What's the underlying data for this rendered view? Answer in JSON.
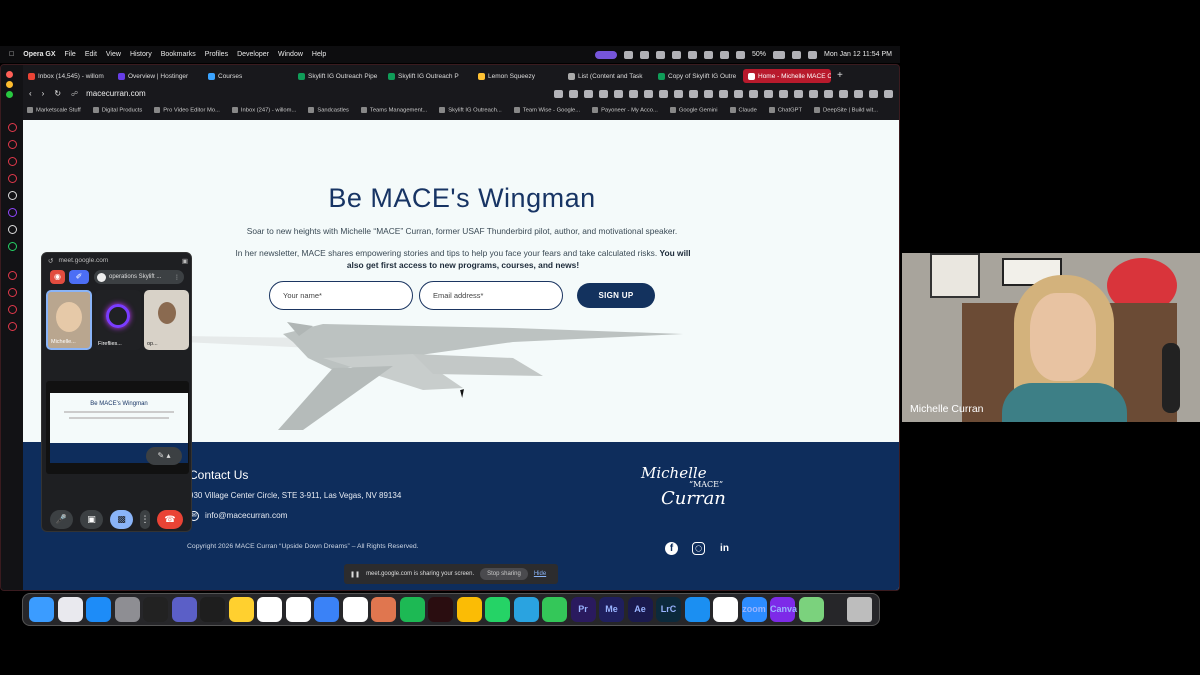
{
  "menubar": {
    "app": "Opera GX",
    "menus": [
      "File",
      "Edit",
      "View",
      "History",
      "Bookmarks",
      "Profiles",
      "Developer",
      "Window",
      "Help"
    ],
    "battery": "50%",
    "datetime": "Mon Jan 12  11:54 PM"
  },
  "browser": {
    "tabs": [
      {
        "label": "Inbox (14,545) - willom",
        "color": "#ea4335"
      },
      {
        "label": "Overview | Hostinger",
        "color": "#673de6"
      },
      {
        "label": "Courses",
        "color": "#3aa3ff"
      },
      {
        "label": "Skylift IG Outreach Pipe",
        "color": "#0f9d58"
      },
      {
        "label": "Skylift IG Outreach P",
        "color": "#0f9d58"
      },
      {
        "label": "Lemon Squeezy",
        "color": "#ffc233"
      },
      {
        "label": "List (Content and Task",
        "color": "#aaaaaa"
      },
      {
        "label": "Copy of Skylift IG Outre",
        "color": "#0f9d58"
      },
      {
        "label": "Home - Michelle MACE C",
        "color": "#ffffff"
      }
    ],
    "url": "macecurran.com",
    "bookmarks": [
      "Marketscale Stuff",
      "Digital Products",
      "Pro Video Editor Mo...",
      "Inbox (247) - willom...",
      "Sandcastles",
      "Teams Management...",
      "Skylift IG Outreach...",
      "Team Wise - Google...",
      "Payoneer - My Acco...",
      "Google Gemini",
      "Claude",
      "ChatGPT",
      "DeepSite | Build wit..."
    ]
  },
  "page": {
    "title": "Be MACE's Wingman",
    "subtitle": "Soar to new heights with Michelle “MACE” Curran, former USAF Thunderbird pilot, author, and motivational speaker.",
    "para_normal": "In her newsletter, MACE shares empowering stories and tips to help you face your fears and take calculated risks.",
    "para_bold": "You will also get first access to new programs, courses, and news!",
    "name_placeholder": "Your name*",
    "email_placeholder": "Email address*",
    "signup_label": "SIGN UP"
  },
  "footer": {
    "contact_heading": "Contact Us",
    "address": "930 Village Center Circle, STE 3-911, Las Vegas, NV 89134",
    "email": "info@macecurran.com",
    "copyright": "Copyright 2026 MACE Curran “Upside Down Dreams” – All Rights Reserved.",
    "logo_line1": "Michelle",
    "logo_line2": "“MACE”",
    "logo_line3": "Curran"
  },
  "share": {
    "message": "meet.google.com is sharing your screen.",
    "stop_label": "Stop sharing",
    "hide_label": "Hide"
  },
  "meet": {
    "url": "meet.google.com",
    "call_name": "operations Skylift ...",
    "tiles": [
      "Michelle...",
      "Fireflies...",
      "op..."
    ],
    "preview_title": "Be MACE's Wingman"
  },
  "webcam": {
    "name": "Michelle Curran"
  },
  "dock": {
    "apps": [
      {
        "name": "finder-icon",
        "color": "#3b9cff"
      },
      {
        "name": "launchpad-icon",
        "color": "#e9e9ee"
      },
      {
        "name": "app-store-icon",
        "color": "#1d8cf8"
      },
      {
        "name": "settings-icon",
        "color": "#8e8e93"
      },
      {
        "name": "screen-recorder-icon",
        "color": "#222222"
      },
      {
        "name": "teams-icon",
        "color": "#5b5fc7"
      },
      {
        "name": "figma-icon",
        "color": "#1e1e1e"
      },
      {
        "name": "miro-icon",
        "color": "#ffd02f"
      },
      {
        "name": "notion-icon",
        "color": "#ffffff"
      },
      {
        "name": "slack-icon",
        "color": "#ffffff"
      },
      {
        "name": "tasks-icon",
        "color": "#3a82f7"
      },
      {
        "name": "chatgpt-icon",
        "color": "#ffffff"
      },
      {
        "name": "claude-icon",
        "color": "#e0764f"
      },
      {
        "name": "spotify-icon",
        "color": "#1db954"
      },
      {
        "name": "opera-icon",
        "color": "#2a0d10"
      },
      {
        "name": "chrome-icon",
        "color": "#fbbc05"
      },
      {
        "name": "whatsapp-icon",
        "color": "#25d366"
      },
      {
        "name": "telegram-icon",
        "color": "#2aa3e0"
      },
      {
        "name": "facetime-icon",
        "color": "#34c759"
      },
      {
        "name": "premiere-icon",
        "color": "#2a1a5e"
      },
      {
        "name": "media-encoder-icon",
        "color": "#1f1f5e"
      },
      {
        "name": "after-effects-icon",
        "color": "#1a1a4e"
      },
      {
        "name": "lightroom-classic-icon",
        "color": "#0c2a3c"
      },
      {
        "name": "perplexity-icon",
        "color": "#1b8ff2"
      },
      {
        "name": "arc-icon",
        "color": "#ffffff"
      },
      {
        "name": "zoom-icon",
        "color": "#2d8cff"
      },
      {
        "name": "canva-icon",
        "color": "#7d2ae8"
      },
      {
        "name": "maps-icon",
        "color": "#7bd27d"
      },
      {
        "name": "trash-icon",
        "color": "#bdbdbd"
      }
    ],
    "labels": {
      "premiere": "Pr",
      "media_encoder": "Me",
      "after_effects": "Ae",
      "lightroom": "LrC",
      "zoom": "zoom",
      "canva": "Canva"
    }
  }
}
